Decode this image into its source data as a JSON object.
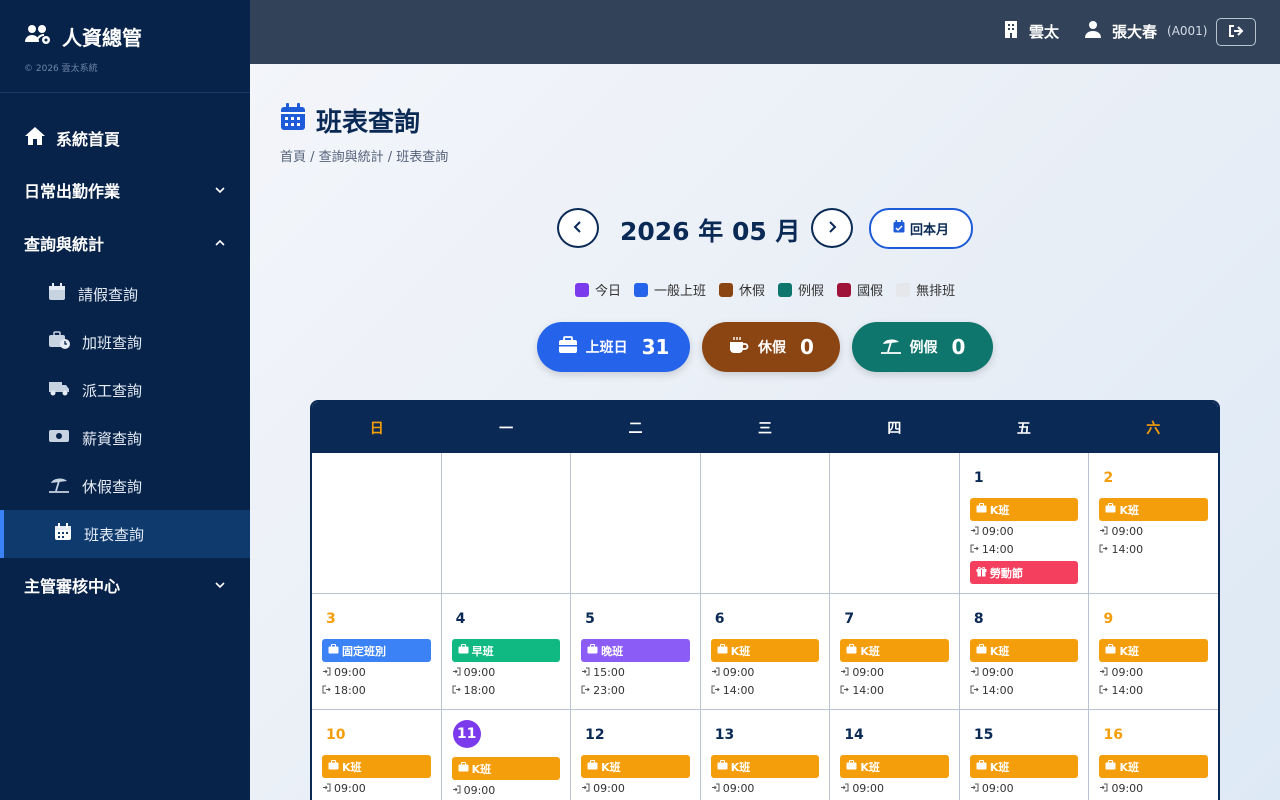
{
  "app": {
    "title": "人資總管",
    "copyright": "© 2026 雲太系統"
  },
  "sidebar": {
    "home": "系統首頁",
    "daily": "日常出勤作業",
    "query": "查詢與統計",
    "sub": [
      "請假查詢",
      "加班查詢",
      "派工查詢",
      "薪資查詢",
      "休假查詢",
      "班表查詢"
    ],
    "manager": "主管審核中心"
  },
  "topbar": {
    "org": "雲太",
    "user": "張大春",
    "emp_id": "(A001)"
  },
  "page": {
    "title": "班表查詢",
    "breadcrumb": "首頁 / 查詢與統計 / 班表查詢"
  },
  "month": {
    "label": "2026 年 05 月",
    "today_button": "回本月"
  },
  "legend": [
    {
      "label": "今日",
      "color": "#7c3aed"
    },
    {
      "label": "一般上班",
      "color": "#2563eb"
    },
    {
      "label": "休假",
      "color": "#8b4513"
    },
    {
      "label": "例假",
      "color": "#0f766e"
    },
    {
      "label": "國假",
      "color": "#9f1239"
    },
    {
      "label": "無排班",
      "color": "#e5e7eb"
    }
  ],
  "stats": {
    "work": {
      "label": "上班日",
      "value": "31",
      "color": "#2563eb"
    },
    "leave": {
      "label": "休假",
      "value": "0",
      "color": "#8b4513"
    },
    "rest": {
      "label": "例假",
      "value": "0",
      "color": "#0f766e"
    }
  },
  "weekdays": [
    "日",
    "一",
    "二",
    "三",
    "四",
    "五",
    "六"
  ],
  "shift_colors": {
    "K班": "#f59e0b",
    "固定班別": "#3b82f6",
    "早班": "#10b981",
    "晚班": "#8b5cf6"
  },
  "weeks": [
    [
      null,
      null,
      null,
      null,
      null,
      {
        "day": "1",
        "shift": "K班",
        "in": "09:00",
        "out": "14:00",
        "holiday": "勞動節"
      },
      {
        "day": "2",
        "shift": "K班",
        "in": "09:00",
        "out": "14:00"
      }
    ],
    [
      {
        "day": "3",
        "shift": "固定班別",
        "in": "09:00",
        "out": "18:00"
      },
      {
        "day": "4",
        "shift": "早班",
        "in": "09:00",
        "out": "18:00"
      },
      {
        "day": "5",
        "shift": "晚班",
        "in": "15:00",
        "out": "23:00"
      },
      {
        "day": "6",
        "shift": "K班",
        "in": "09:00",
        "out": "14:00"
      },
      {
        "day": "7",
        "shift": "K班",
        "in": "09:00",
        "out": "14:00"
      },
      {
        "day": "8",
        "shift": "K班",
        "in": "09:00",
        "out": "14:00"
      },
      {
        "day": "9",
        "shift": "K班",
        "in": "09:00",
        "out": "14:00"
      }
    ],
    [
      {
        "day": "10",
        "shift": "K班",
        "in": "09:00"
      },
      {
        "day": "11",
        "shift": "K班",
        "in": "09:00",
        "today": true
      },
      {
        "day": "12",
        "shift": "K班",
        "in": "09:00"
      },
      {
        "day": "13",
        "shift": "K班",
        "in": "09:00"
      },
      {
        "day": "14",
        "shift": "K班",
        "in": "09:00"
      },
      {
        "day": "15",
        "shift": "K班",
        "in": "09:00"
      },
      {
        "day": "16",
        "shift": "K班",
        "in": "09:00"
      }
    ]
  ]
}
